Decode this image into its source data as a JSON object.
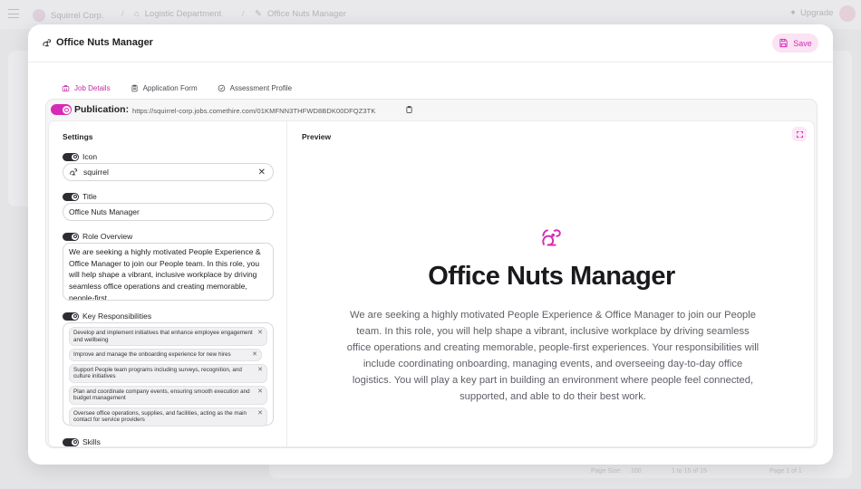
{
  "background": {
    "breadcrumb": [
      "Squirrel Corp.",
      "Logistic Department",
      "Office Nuts Manager"
    ],
    "upgrade_label": "Upgrade",
    "pagination": {
      "page_size_label": "Page Size:",
      "page_size": "100",
      "range": "1 to 15 of 15",
      "page": "Page 1 of 1"
    }
  },
  "modal": {
    "title": "Office Nuts Manager",
    "save_label": "Save",
    "tabs": [
      {
        "label": "Job Details",
        "active": true,
        "icon": "briefcase-icon"
      },
      {
        "label": "Application Form",
        "active": false,
        "icon": "clipboard-icon"
      },
      {
        "label": "Assessment Profile",
        "active": false,
        "icon": "check-circle-icon"
      }
    ],
    "publication": {
      "label": "Publication:",
      "url": "https://squirrel-corp.jobs.comethire.com/01KMFNN3THFWD8BDK00DFQZ3TK"
    },
    "settings": {
      "title": "Settings",
      "icon_field": {
        "label": "Icon",
        "value": "squirrel"
      },
      "title_field": {
        "label": "Title",
        "value": "Office Nuts Manager"
      },
      "overview_field": {
        "label": "Role Overview",
        "value": "We are seeking a highly motivated People Experience & Office Manager to join our People team. In this role, you will help shape a vibrant, inclusive workplace by driving seamless office operations and creating memorable, people-first"
      },
      "responsibilities_field": {
        "label": "Key Responsibilities",
        "items": [
          "Develop and implement initiatives that enhance employee engagement and wellbeing",
          "Improve and manage the onboarding experience for new hires",
          "Support People team programs including surveys, recognition, and culture initiatives",
          "Plan and coordinate company events, ensuring smooth execution and budget management",
          "Oversee office operations, supplies, and facilities, acting as the main contact for service providers"
        ]
      },
      "skills_field": {
        "label": "Skills"
      }
    },
    "preview": {
      "title": "Preview",
      "heading": "Office Nuts Manager",
      "body": "We are seeking a highly motivated People Experience & Office Manager to join our People team. In this role, you will help shape a vibrant, inclusive workplace by driving seamless office operations and creating memorable, people-first experiences. Your responsibilities will include coordinating onboarding, managing events, and overseeing day-to-day office logistics. You will play a key part in building an environment where people feel connected, supported, and able to do their best work."
    },
    "accent_color": "#d62bb4"
  }
}
